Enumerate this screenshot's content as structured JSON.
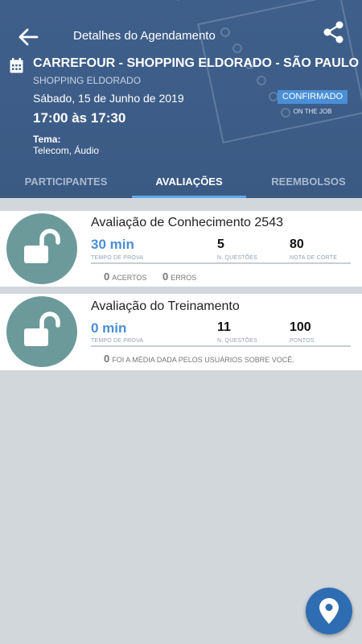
{
  "header": {
    "title": "Detalhes do Agendamento",
    "store": "CARREFOUR - SHOPPING ELDORADO - SÃO PAULO",
    "mall": "SHOPPING ELDORADO",
    "date": "Sábado, 15 de Junho de 2019",
    "time": "17:00 às 17:30",
    "status": "CONFIRMADO",
    "status_sub": "ON THE JOB",
    "tema_label": "Tema:",
    "tema_value": "Telecom, Áudio"
  },
  "tabs": [
    "PARTICIPANTES",
    "AVALIAÇÕES",
    "REEMBOLSOS"
  ],
  "evaluations": [
    {
      "title": "Avaliação de Conhecimento 2543",
      "time_value": "30 min",
      "time_label": "TEMPO DE PROVA",
      "questions_value": "5",
      "questions_label": "N. QUESTÕES",
      "score_value": "80",
      "score_label": "NOTA DE CORTE",
      "acertos_value": "0",
      "acertos_label": "ACERTOS",
      "erros_value": "0",
      "erros_label": "ERROS"
    },
    {
      "title": "Avaliação do Treinamento",
      "time_value": "0 min",
      "time_label": "TEMPO DE PROVA",
      "questions_value": "11",
      "questions_label": "N. QUESTÕES",
      "score_value": "100",
      "score_label": "PONTOS",
      "media_value": "0",
      "media_label": "FOI A MÉDIA DADA PELOS USUÁRIOS SOBRE VOCÊ."
    }
  ],
  "colors": {
    "header": "#3d5d88",
    "accent": "#4a8fd6",
    "lock": "#6c9a9b",
    "fab": "#2f6db3"
  },
  "icons": [
    "back-arrow-icon",
    "share-icon",
    "calendar-icon",
    "unlock-icon",
    "map-pin-icon"
  ]
}
